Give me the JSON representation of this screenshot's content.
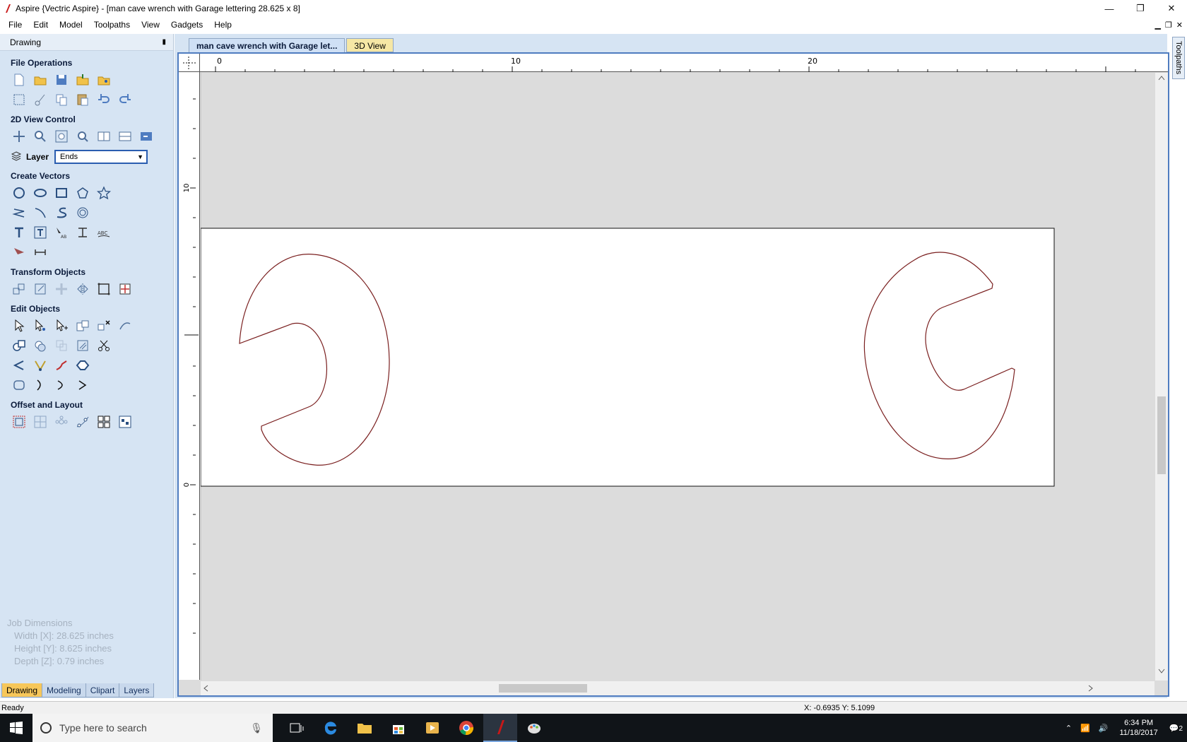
{
  "window": {
    "title": "Aspire {Vectric Aspire} - [man cave wrench with Garage lettering 28.625 x 8]",
    "minimize": "—",
    "restore": "❐",
    "close": "✕"
  },
  "menu": [
    "File",
    "Edit",
    "Model",
    "Toolpaths",
    "View",
    "Gadgets",
    "Help"
  ],
  "panel": {
    "header": "Drawing",
    "pin": "📌",
    "sections": {
      "file_operations": "File Operations",
      "view_control": "2D View Control",
      "create_vectors": "Create Vectors",
      "transform_objects": "Transform Objects",
      "edit_objects": "Edit Objects",
      "offset_layout": "Offset and Layout"
    },
    "layer_label": "Layer",
    "layer_value": "Ends",
    "job_dimensions": {
      "heading": "Job Dimensions",
      "width": "Width  [X]: 28.625 inches",
      "height": "Height [Y]: 8.625 inches",
      "depth": "Depth  [Z]: 0.79 inches"
    },
    "bottom_tabs": [
      "Drawing",
      "Modeling",
      "Clipart",
      "Layers"
    ]
  },
  "document": {
    "tab_active": "man cave wrench with Garage let...",
    "tab_3d": "3D View",
    "ruler_top_labels": [
      "0",
      "10",
      "20"
    ],
    "ruler_left_labels": [
      "10",
      "0"
    ]
  },
  "right_strip": {
    "tab": "Toolpaths"
  },
  "status": {
    "ready": "Ready",
    "coords": "X: -0.6935 Y:  5.1099"
  },
  "taskbar": {
    "search_placeholder": "Type here to search",
    "time": "6:34 PM",
    "date": "11/18/2017",
    "notifications": "2"
  },
  "colors": {
    "panel_bg": "#d6e4f3",
    "accent": "#4f7cc0",
    "vector": "#7a1f1f",
    "active_tab": "#f7c75a"
  }
}
